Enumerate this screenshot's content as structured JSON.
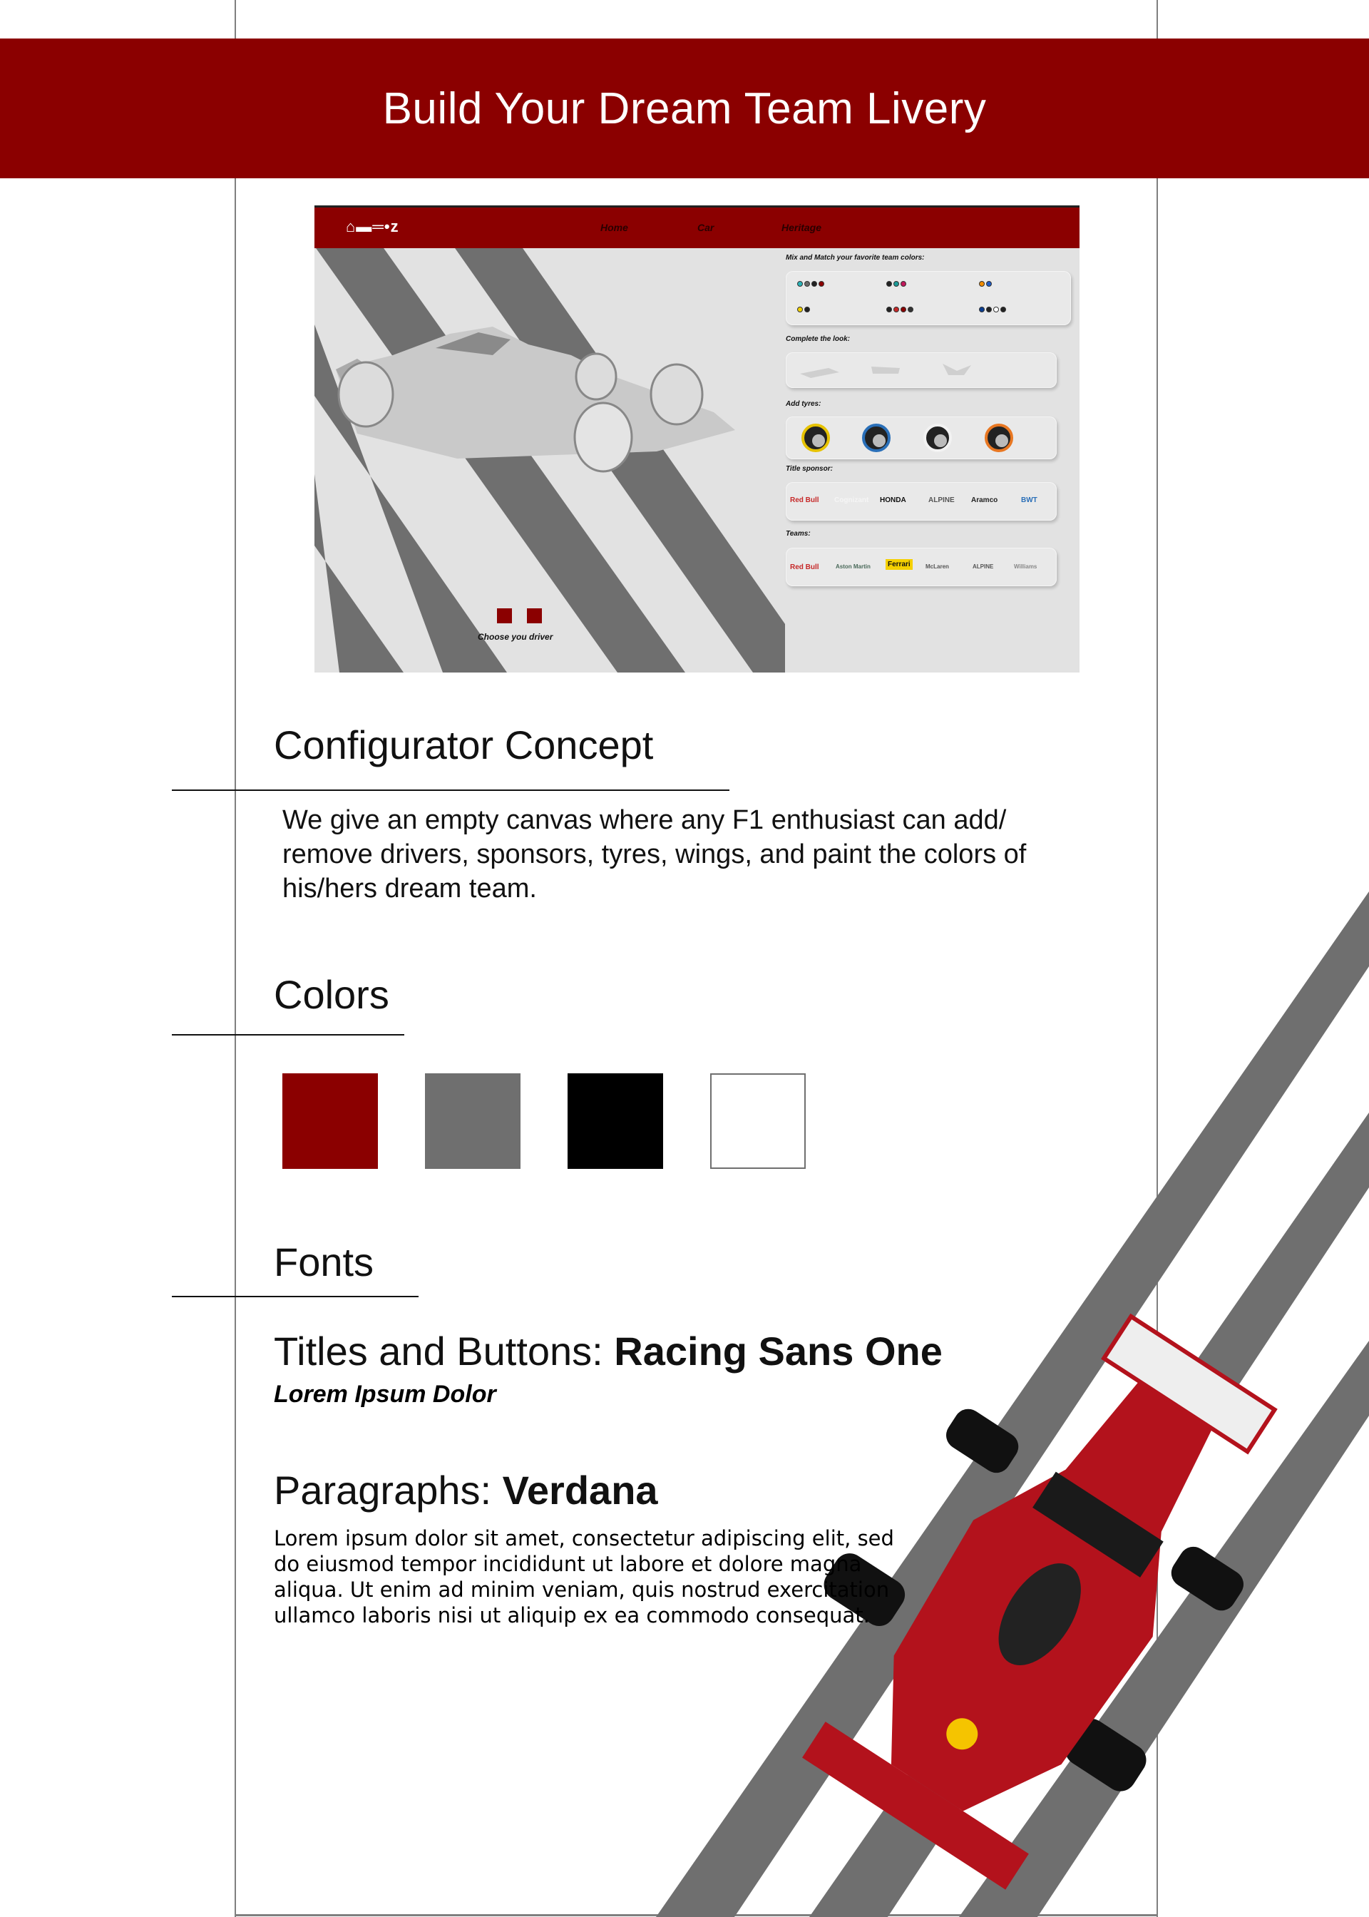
{
  "header": {
    "title": "Build Your Dream Team Livery"
  },
  "mockup": {
    "logo": "⌂▬═•z",
    "nav": {
      "home": "Home",
      "car": "Car",
      "heritage": "Heritage"
    },
    "choose_driver": "Choose you driver",
    "panel": {
      "colors_title": "Mix and Match your favorite team colors:",
      "look_title": "Complete the look:",
      "tyres_title": "Add tyres:",
      "sponsor_title": "Title sponsor:",
      "teams_title": "Teams:",
      "sponsors": [
        "Red Bull",
        "Cognizant",
        "HONDA",
        "ALPINE",
        "Aramco",
        "BWT"
      ],
      "teams": [
        "Red Bull",
        "Aston Martin",
        "Ferrari",
        "McLaren",
        "ALPINE",
        "Williams"
      ]
    }
  },
  "concept": {
    "title": "Configurator Concept",
    "body": "We give an empty canvas where any F1 enthusiast can add/ remove drivers, sponsors,  tyres, wings, and paint the colors of his/hers dream team."
  },
  "colors": {
    "title": "Colors",
    "swatches": [
      "#8b0000",
      "#6f6f6f",
      "#000000",
      "#ffffff"
    ]
  },
  "fonts": {
    "title": "Fonts",
    "titles_label": "Titles and Buttons: ",
    "titles_font": "Racing Sans One",
    "titles_sample": "Lorem Ipsum Dolor",
    "paragraphs_label": "Paragraphs: ",
    "paragraphs_font": "Verdana",
    "paragraph_sample": "Lorem ipsum dolor sit amet, consectetur adipiscing elit, sed do eiusmod tempor incididunt ut labore et dolore magna aliqua. Ut enim ad minim veniam, quis nostrud exercitation ullamco laboris nisi ut aliquip ex ea commodo consequat."
  },
  "theme": {
    "accent": "#8b0000",
    "stripe": "#6f6f6f",
    "mock_bg": "#e2e2e2"
  }
}
